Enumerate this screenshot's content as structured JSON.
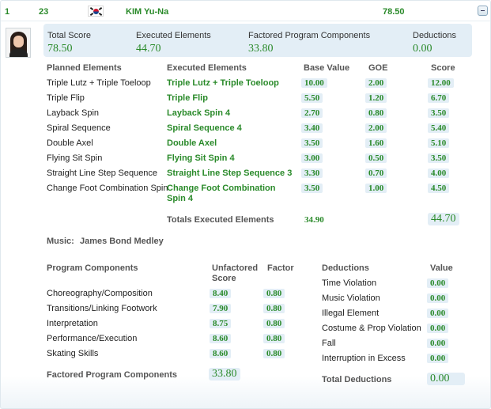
{
  "header": {
    "rank": "1",
    "start_number": "23",
    "athlete_name": "KIM Yu-Na",
    "total_score": "78.50",
    "flag_icon": "south-korea-flag-icon",
    "collapse_icon": "minus-collapse-icon"
  },
  "summary": {
    "total_score_label": "Total Score",
    "total_score_value": "78.50",
    "executed_label": "Executed Elements",
    "executed_value": "44.70",
    "factored_label": "Factored Program Components",
    "factored_value": "33.80",
    "deductions_label": "Deductions",
    "deductions_value": "0.00"
  },
  "elements": {
    "headers": {
      "planned": "Planned Elements",
      "executed": "Executed Elements",
      "base": "Base Value",
      "goe": "GOE",
      "score": "Score"
    },
    "rows": [
      {
        "planned": "Triple Lutz + Triple Toeloop",
        "executed": "Triple Lutz + Triple Toeloop",
        "base": "10.00",
        "goe": "2.00",
        "score": "12.00"
      },
      {
        "planned": "Triple Flip",
        "executed": "Triple Flip",
        "base": "5.50",
        "goe": "1.20",
        "score": "6.70"
      },
      {
        "planned": "Layback Spin",
        "executed": "Layback Spin 4",
        "base": "2.70",
        "goe": "0.80",
        "score": "3.50"
      },
      {
        "planned": "Spiral Sequence",
        "executed": "Spiral Sequence 4",
        "base": "3.40",
        "goe": "2.00",
        "score": "5.40"
      },
      {
        "planned": "Double Axel",
        "executed": "Double Axel",
        "base": "3.50",
        "goe": "1.60",
        "score": "5.10"
      },
      {
        "planned": "Flying Sit Spin",
        "executed": "Flying Sit Spin 4",
        "base": "3.00",
        "goe": "0.50",
        "score": "3.50"
      },
      {
        "planned": "Straight Line Step Sequence",
        "executed": "Straight Line Step Sequence 3",
        "base": "3.30",
        "goe": "0.70",
        "score": "4.00"
      },
      {
        "planned": "Change Foot Combination Spin",
        "executed": "Change Foot Combination",
        "executed_line2": "Spin 4",
        "base": "3.50",
        "goe": "1.00",
        "score": "4.50"
      }
    ],
    "totals_label": "Totals Executed Elements",
    "totals_base": "34.90",
    "totals_score": "44.70"
  },
  "music": {
    "label": "Music:",
    "title": "James Bond Medley"
  },
  "components": {
    "header": "Program Components",
    "unfactored_header_1": "Unfactored",
    "unfactored_header_2": "Score",
    "factor_header": "Factor",
    "rows": [
      {
        "name": "Choreography/Composition",
        "score": "8.40",
        "factor": "0.80"
      },
      {
        "name": "Transitions/Linking Footwork",
        "score": "7.90",
        "factor": "0.80"
      },
      {
        "name": "Interpretation",
        "score": "8.75",
        "factor": "0.80"
      },
      {
        "name": "Performance/Execution",
        "score": "8.60",
        "factor": "0.80"
      },
      {
        "name": "Skating Skills",
        "score": "8.60",
        "factor": "0.80"
      }
    ],
    "total_label": "Factored Program Components",
    "total_value": "33.80"
  },
  "deductions": {
    "header": "Deductions",
    "value_header": "Value",
    "rows": [
      {
        "name": "Time Violation",
        "value": "0.00"
      },
      {
        "name": "Music Violation",
        "value": "0.00"
      },
      {
        "name": "Illegal Element",
        "value": "0.00"
      },
      {
        "name": "Costume & Prop Violation",
        "value": "0.00"
      },
      {
        "name": "Fall",
        "value": "0.00"
      },
      {
        "name": "Interruption in Excess",
        "value": "0.00"
      }
    ],
    "total_label": "Total Deductions",
    "total_value": "0.00"
  }
}
